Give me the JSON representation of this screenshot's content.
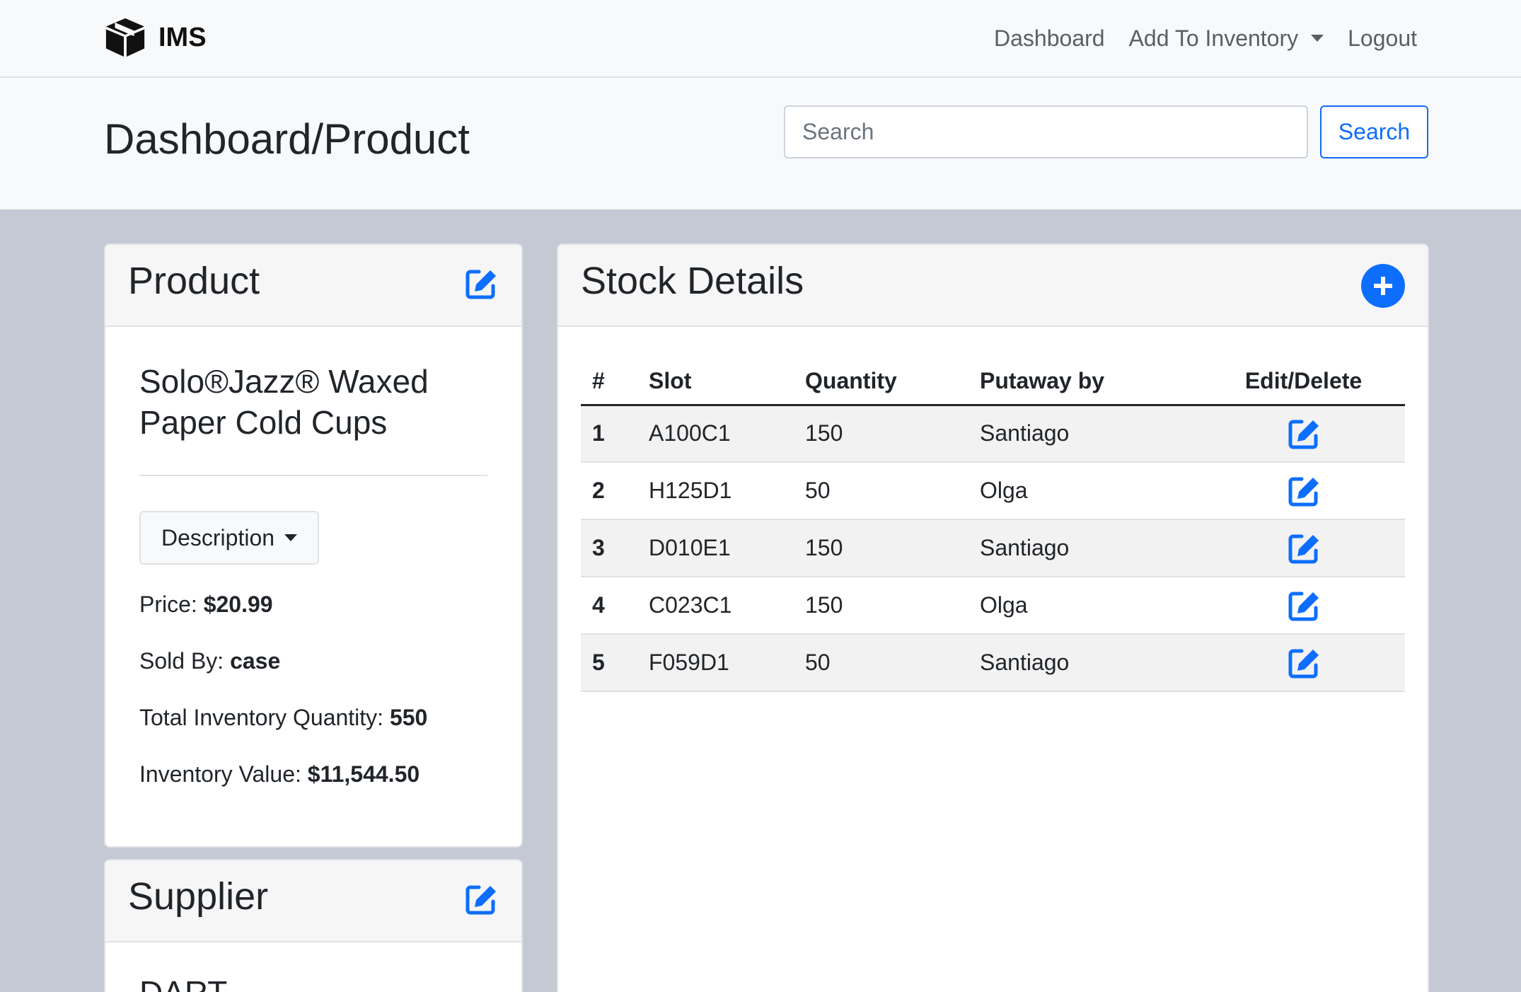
{
  "nav": {
    "brand": "IMS",
    "links": [
      "Dashboard",
      "Add To Inventory",
      "Logout"
    ]
  },
  "header": {
    "title": "Dashboard/Product",
    "search_placeholder": "Search",
    "search_button": "Search"
  },
  "product": {
    "card_title": "Product",
    "name": "Solo®Jazz® Waxed Paper Cold Cups",
    "description_button": "Description",
    "price_label": "Price:",
    "price_value": "$20.99",
    "sold_by_label": "Sold By:",
    "sold_by_value": "case",
    "total_qty_label": "Total Inventory Quantity:",
    "total_qty_value": "550",
    "inv_value_label": "Inventory Value:",
    "inv_value_value": "$11,544.50"
  },
  "supplier": {
    "card_title": "Supplier",
    "name": "DART"
  },
  "stock": {
    "card_title": "Stock Details",
    "columns": [
      "#",
      "Slot",
      "Quantity",
      "Putaway by",
      "Edit/Delete"
    ],
    "rows": [
      {
        "num": "1",
        "slot": "A100C1",
        "quantity": "150",
        "putaway_by": "Santiago"
      },
      {
        "num": "2",
        "slot": "H125D1",
        "quantity": "50",
        "putaway_by": "Olga"
      },
      {
        "num": "3",
        "slot": "D010E1",
        "quantity": "150",
        "putaway_by": "Santiago"
      },
      {
        "num": "4",
        "slot": "C023C1",
        "quantity": "150",
        "putaway_by": "Olga"
      },
      {
        "num": "5",
        "slot": "F059D1",
        "quantity": "50",
        "putaway_by": "Santiago"
      }
    ]
  },
  "colors": {
    "primary": "#0d6efd",
    "background": "#c4c9d4",
    "light": "#f8f9fa"
  },
  "icons": [
    "box-icon",
    "edit-icon",
    "plus-circle-icon",
    "caret-down-icon"
  ]
}
